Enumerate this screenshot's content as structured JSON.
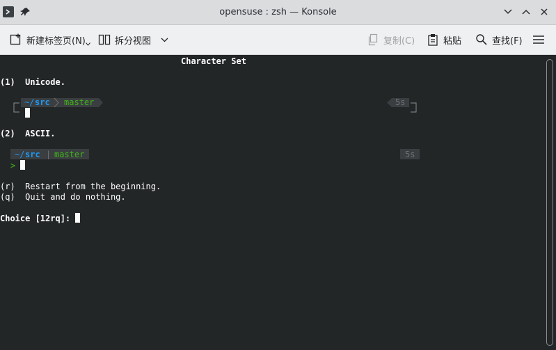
{
  "window": {
    "title": "opensuse : zsh — Konsole"
  },
  "toolbar": {
    "new_tab": "新建标签页(N)",
    "split_view": "拆分视图",
    "copy": "复制(C)",
    "paste": "粘贴",
    "find": "查找(F)"
  },
  "terminal": {
    "heading": "Character Set",
    "opt1": "(1)  Unicode.",
    "opt2": "(2)  ASCII.",
    "opt_r": "(r)  Restart from the beginning.",
    "opt_q": "(q)  Quit and do nothing.",
    "choice": "Choice [12rq]: ",
    "unicode_prompt": {
      "dir_tilde": "~/",
      "dir_name": "src",
      "branch": "master",
      "time": "5s"
    },
    "ascii_prompt": {
      "dir_tilde": "~/",
      "dir_name": "src",
      "sep": "|",
      "branch": "master",
      "time": "5s",
      "arrow": ">"
    }
  },
  "colors": {
    "blue": "#1d99f3",
    "green": "#3fb516",
    "segment_bg": "#3a3e41",
    "time": "#6e7275"
  }
}
